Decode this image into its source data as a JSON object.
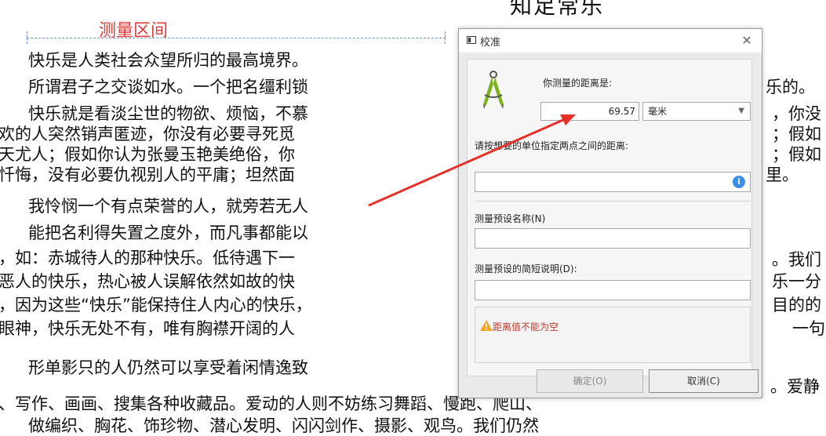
{
  "document": {
    "title": "知足常乐",
    "measure_label": "测量区间",
    "lines": [
      "快乐是人类社会众望所归的最高境界。",
      "所谓君子之交谈如水。一个把名缰利锁",
      "快乐就是看淡尘世的物欲、烦恼，不慕",
      "欢的人突然销声匿迹，你没有必要寻死觅",
      "天尤人；假如你认为张曼玉艳美绝俗，你",
      "忏悔，没有必要仇视别人的平庸；坦然面",
      "我怜悯一个有点荣誉的人，就旁若无人",
      "能把名利得失置之度外，而凡事都能以",
      "，如：赤城待人的那种快乐。低待遇下一",
      "恶人的快乐，热心被人误解依然如故的快",
      "，因为这些“快乐”能保持住人内心的快乐，",
      "眼神，快乐无处不有，唯有胸襟开阔的人",
      "形单影只的人仍然可以享受着闲情逸致",
      "、写作、画画、搜集各种收藏品。爱动的人则不妨练习舞蹈、慢跑、爬山、",
      "做编织、胸花、饰珍物、潜心发明、闪闪剑作、摄影、观鸟。我们仍然"
    ],
    "right_fragments": [
      "乐的。",
      "，你没",
      "；假如",
      "；假如",
      "里。",
      "。我们",
      "乐一分",
      "目的的",
      "一句",
      "。爱静"
    ]
  },
  "dialog": {
    "title": "校准",
    "distance_label": "你测量的距离是:",
    "distance_value": "69.57",
    "unit": "毫米",
    "instruction": "请按想要的单位指定两点之间的距离:",
    "preset_name_label": "测量预设名称(N)",
    "preset_desc_label": "测量预设的简短说明(D):",
    "warning": "距离值不能为空",
    "ok_label": "确定(O)",
    "cancel_label": "取消(C)",
    "close_glyph": "✕",
    "info_glyph": "i"
  },
  "colors": {
    "measure_label": "#e23b3b",
    "arrow": "#e8302a",
    "compass_green": "#7bb31b",
    "info_blue": "#3b8ee8",
    "warning_orange": "#f5a623"
  }
}
